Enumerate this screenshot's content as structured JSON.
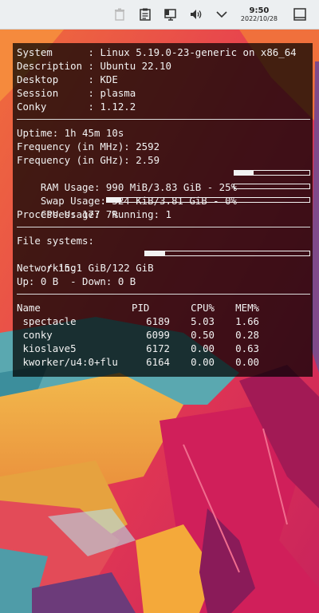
{
  "panel": {
    "time": "9:50",
    "date": "2022/10/28",
    "icons": [
      "trash-icon",
      "clipboard-icon",
      "display-icon",
      "volume-icon",
      "chevron-down-icon",
      "desktop-icon"
    ]
  },
  "colors": {
    "panel_bg": "#eceff1",
    "conky_bg": "rgba(0,0,0,0.72)",
    "conky_text": "#f2f2f2"
  },
  "system": {
    "rows": [
      {
        "label": "System     ",
        "value": ": Linux 5.19.0-23-generic on x86_64"
      },
      {
        "label": "Description",
        "value": ": Ubuntu 22.10"
      },
      {
        "label": "Desktop    ",
        "value": ": KDE"
      },
      {
        "label": "Session    ",
        "value": ": plasma"
      },
      {
        "label": "Conky      ",
        "value": ": 1.12.2"
      }
    ]
  },
  "stats": {
    "uptime": "Uptime: 1h 45m 10s",
    "freq_mhz": "Frequency (in MHz): 2592",
    "freq_ghz": "Frequency (in GHz): 2.59",
    "ram_text": "RAM Usage: 990 MiB/3.83 GiB - 25%",
    "ram_pct": 25,
    "swap_text": "Swap Usage: 524 KiB/3.81 GiB - 0%",
    "swap_pct": 0,
    "cpu_text": "CPU Usage: 7%",
    "cpu_pct": 7,
    "processes": "Processes: 177  Running: 1"
  },
  "fs": {
    "title": "File systems:",
    "root_text": " / 15.1 GiB/122 GiB",
    "root_pct": 12,
    "net_title": "Networking:",
    "net_text": "Up: 0 B  - Down: 0 B"
  },
  "procs": {
    "headers": {
      "name": "Name",
      "pid": "PID",
      "cpu": "CPU%",
      "mem": "MEM%"
    },
    "rows": [
      {
        "name": " spectacle",
        "pid": "6189",
        "cpu": "5.03",
        "mem": "1.66"
      },
      {
        "name": " conky",
        "pid": "6099",
        "cpu": "0.50",
        "mem": "0.28"
      },
      {
        "name": " kioslave5",
        "pid": "6172",
        "cpu": "0.00",
        "mem": "0.63"
      },
      {
        "name": " kworker/u4:0+flu",
        "pid": "6164",
        "cpu": "0.00",
        "mem": "0.00"
      }
    ]
  }
}
